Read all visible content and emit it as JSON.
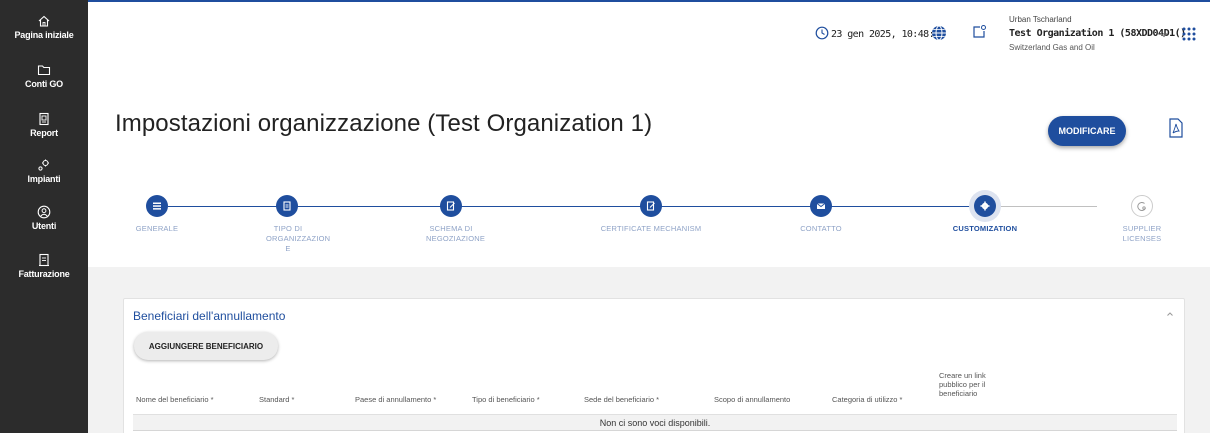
{
  "sidebar": {
    "items": [
      {
        "label": "Pagina iniziale",
        "icon": "home-icon"
      },
      {
        "label": "Conti GO",
        "icon": "folder-icon"
      },
      {
        "label": "Report",
        "icon": "report-icon"
      },
      {
        "label": "Impianti",
        "icon": "plant-icon"
      },
      {
        "label": "Utenti",
        "icon": "user-icon"
      },
      {
        "label": "Fatturazione",
        "icon": "invoice-icon"
      }
    ]
  },
  "header": {
    "datetime": "23 gen 2025, 10:48:01",
    "user_name": "Urban Tscharland",
    "org_name": "Test Organization 1 (58XDD04D1()",
    "org_sub": "Switzerland Gas and Oil"
  },
  "page": {
    "title": "Impostazioni organizzazione (Test Organization 1)",
    "modify_label": "MODIFICARE"
  },
  "stepper": {
    "steps": [
      {
        "label": "GENERALE",
        "state": "done"
      },
      {
        "label": "TIPO DI ORGANIZZAZION E",
        "state": "done"
      },
      {
        "label": "SCHEMA DI NEGOZIAZIONE",
        "state": "done"
      },
      {
        "label": "CERTIFICATE MECHANISM",
        "state": "done"
      },
      {
        "label": "CONTATTO",
        "state": "done"
      },
      {
        "label": "CUSTOMIZATION",
        "state": "active"
      },
      {
        "label": "SUPPLIER LICENSES",
        "state": "pending"
      }
    ]
  },
  "beneficiaries": {
    "title": "Beneficiari dell'annullamento",
    "add_label": "AGGIUNGERE BENEFICIARIO",
    "columns": [
      "Nome del beneficiario *",
      "Standard *",
      "Paese di annullamento *",
      "Tipo di beneficiario *",
      "Sede del beneficiario *",
      "Scopo di annullamento",
      "Categoria di utilizzo *",
      "Creare un link pubblico per il beneficiario"
    ],
    "empty_text": "Non ci sono voci disponibili."
  },
  "colors": {
    "primary": "#1f4e9e",
    "sidebar": "#2c2c2c"
  }
}
